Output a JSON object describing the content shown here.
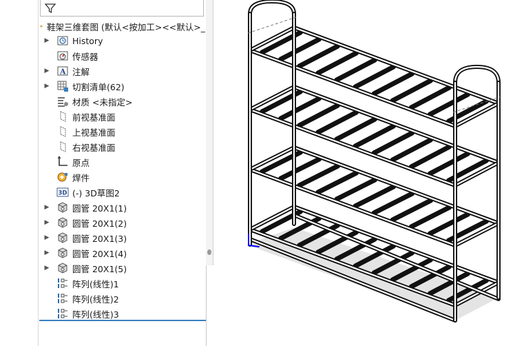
{
  "tree": {
    "root_label": "鞋架三维套图  (默认<按加工><<默认>_",
    "items": [
      {
        "label": "History",
        "icon": "history-icon",
        "expandable": true
      },
      {
        "label": "传感器",
        "icon": "sensor-icon",
        "expandable": false
      },
      {
        "label": "注解",
        "icon": "annotation-icon",
        "expandable": true
      },
      {
        "label": "切割清单(62)",
        "icon": "cut-list-icon",
        "expandable": true
      },
      {
        "label": "材质 <未指定>",
        "icon": "material-icon",
        "expandable": false
      },
      {
        "label": "前视基准面",
        "icon": "plane-icon",
        "expandable": false
      },
      {
        "label": "上视基准面",
        "icon": "plane-icon",
        "expandable": false
      },
      {
        "label": "右视基准面",
        "icon": "plane-icon",
        "expandable": false
      },
      {
        "label": "原点",
        "icon": "origin-icon",
        "expandable": false
      },
      {
        "label": "焊件",
        "icon": "weldment-icon",
        "expandable": false
      },
      {
        "label": "(-) 3D草图2",
        "icon": "3d-sketch-icon",
        "expandable": false
      },
      {
        "label": "圆管 20X1(1)",
        "icon": "structural-member-icon",
        "expandable": true
      },
      {
        "label": "圆管 20X1(2)",
        "icon": "structural-member-icon",
        "expandable": true
      },
      {
        "label": "圆管 20X1(3)",
        "icon": "structural-member-icon",
        "expandable": true
      },
      {
        "label": "圆管 20X1(4)",
        "icon": "structural-member-icon",
        "expandable": true
      },
      {
        "label": "圆管 20X1(5)",
        "icon": "structural-member-icon",
        "expandable": true
      },
      {
        "label": "阵列(线性)1",
        "icon": "linear-pattern-icon",
        "expandable": false
      },
      {
        "label": "阵列(线性)2",
        "icon": "linear-pattern-icon",
        "expandable": false
      },
      {
        "label": "阵列(线性)3",
        "icon": "linear-pattern-icon",
        "expandable": false
      }
    ]
  },
  "viewport": {
    "model": "shoe-rack-4-tier"
  },
  "colors": {
    "accent": "#3a7fc1",
    "frame": "#111111",
    "origin_axis": "#0000ff"
  }
}
